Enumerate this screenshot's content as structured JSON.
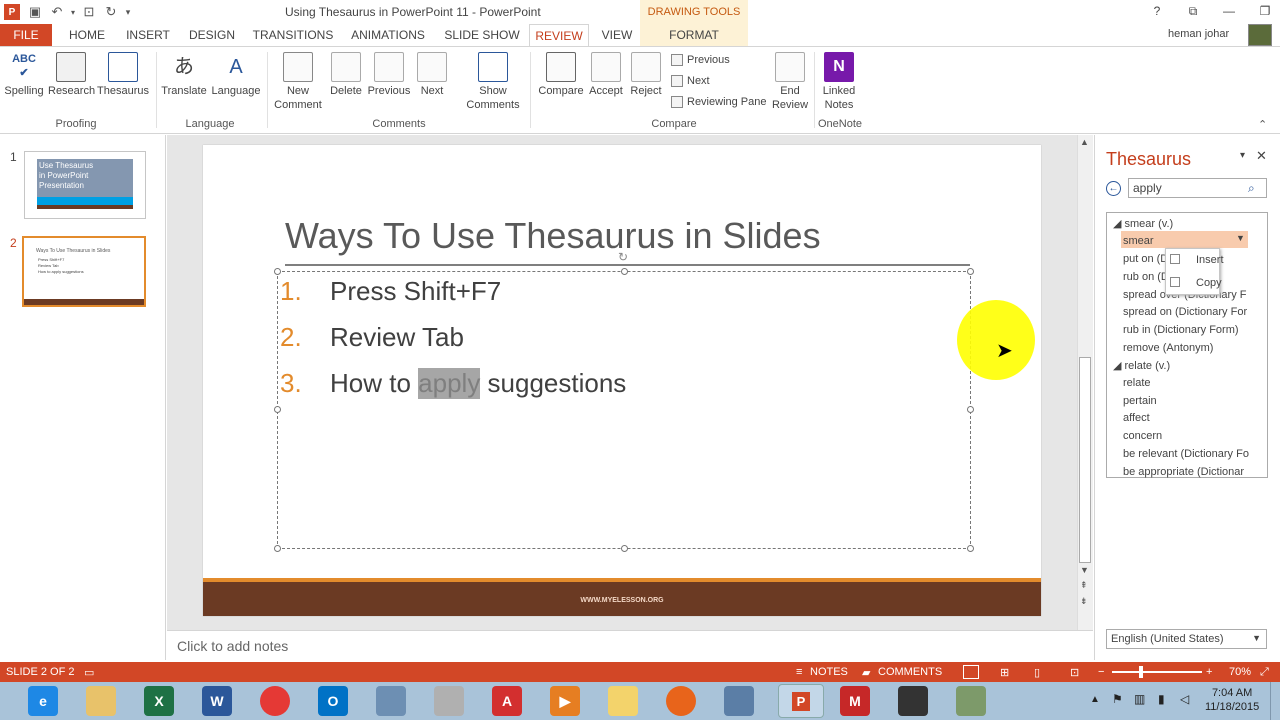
{
  "window": {
    "title": "Using Thesaurus in PowerPoint 11 - PowerPoint",
    "contextual_tab_group": "DRAWING TOOLS",
    "user": "heman johar",
    "help": "?",
    "ribbon_display": "⧉",
    "minimize": "—",
    "maximize": "❐",
    "close": "✕"
  },
  "tabs": [
    "FILE",
    "HOME",
    "INSERT",
    "DESIGN",
    "TRANSITIONS",
    "ANIMATIONS",
    "SLIDE SHOW",
    "REVIEW",
    "VIEW",
    "FORMAT"
  ],
  "ribbon": {
    "proofing": {
      "group": "Proofing",
      "spelling": "Spelling",
      "research": "Research",
      "thesaurus": "Thesaurus"
    },
    "language": {
      "group": "Language",
      "translate": "Translate",
      "language": "Language"
    },
    "comments": {
      "group": "Comments",
      "new_line1": "New",
      "new_line2": "Comment",
      "delete": "Delete",
      "previous": "Previous",
      "next": "Next",
      "show_line1": "Show",
      "show_line2": "Comments"
    },
    "compare": {
      "group": "Compare",
      "compare": "Compare",
      "accept": "Accept",
      "reject": "Reject",
      "previous": "Previous",
      "next": "Next",
      "reviewing_pane": "Reviewing Pane",
      "end_line1": "End",
      "end_line2": "Review"
    },
    "onenote": {
      "group": "OneNote",
      "linked_line1": "Linked",
      "linked_line2": "Notes"
    }
  },
  "thumbnails": [
    {
      "number": "1",
      "title_line1": "Use Thesaurus",
      "title_line2": "in PowerPoint",
      "title_line3": "Presentation"
    },
    {
      "number": "2",
      "title": "Ways To Use Thesaurus in Slides",
      "items": [
        "Press Shift+F7",
        "Review Tab",
        "How to apply suggestions"
      ]
    }
  ],
  "slide": {
    "title": "Ways To Use Thesaurus in Slides",
    "items": [
      {
        "num": "1.",
        "text": "Press Shift+F7"
      },
      {
        "num": "2.",
        "text": "Review Tab"
      },
      {
        "num": "3.",
        "pre": "How to ",
        "highlight": "apply",
        "post": " suggestions"
      }
    ],
    "footer": "WWW.MYELESSON.ORG"
  },
  "notes_placeholder": "Click to add notes",
  "thesaurus": {
    "title": "Thesaurus",
    "search_value": "apply",
    "entries": [
      {
        "type": "head",
        "text": "smear (v.)"
      },
      {
        "type": "word",
        "text": "smear"
      },
      {
        "type": "word",
        "text": "put on (D"
      },
      {
        "type": "word",
        "text": "rub on (D"
      },
      {
        "type": "word",
        "text": "spread over (Dictionary F"
      },
      {
        "type": "word",
        "text": "spread on (Dictionary For"
      },
      {
        "type": "word",
        "text": "rub in (Dictionary Form)"
      },
      {
        "type": "word",
        "text": "remove (Antonym)"
      },
      {
        "type": "head",
        "text": "relate (v.)"
      },
      {
        "type": "word",
        "text": "relate"
      },
      {
        "type": "word",
        "text": "pertain"
      },
      {
        "type": "word",
        "text": "affect"
      },
      {
        "type": "word",
        "text": "concern"
      },
      {
        "type": "word",
        "text": "be relevant (Dictionary Fo"
      },
      {
        "type": "word",
        "text": "be appropriate (Dictionar"
      }
    ],
    "context_menu": [
      "Insert",
      "Copy"
    ],
    "language": "English (United States)"
  },
  "status": {
    "slide": "SLIDE 2 OF 2",
    "notes": "NOTES",
    "comments": "COMMENTS",
    "zoom": "70%"
  },
  "taskbar": {
    "time": "7:04 AM",
    "date": "11/18/2015"
  }
}
